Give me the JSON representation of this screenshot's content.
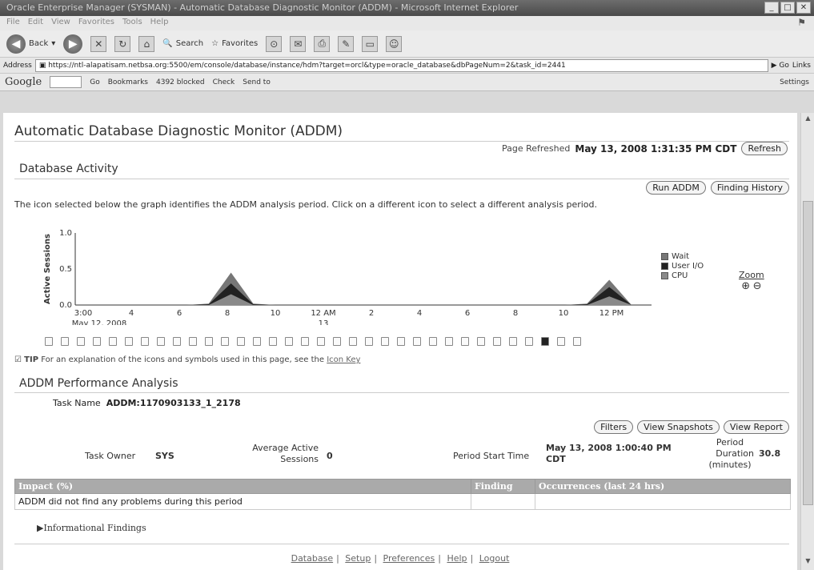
{
  "window": {
    "title": "Oracle Enterprise Manager (SYSMAN) - Automatic Database Diagnostic Monitor (ADDM) - Microsoft Internet Explorer"
  },
  "menu": [
    "File",
    "Edit",
    "View",
    "Favorites",
    "Tools",
    "Help"
  ],
  "toolbar": {
    "back": "Back",
    "search": "Search",
    "favorites": "Favorites"
  },
  "address": {
    "label": "Address",
    "url": "https://ntl-alapatisam.netbsa.org:5500/em/console/database/instance/hdm?target=orcl&type=oracle_database&dbPageNum=2&task_id=2441",
    "go": "Go",
    "links": "Links"
  },
  "googlebar": {
    "logo": "Google",
    "go": "Go",
    "bookmarks": "Bookmarks",
    "blocked": "4392 blocked",
    "check": "Check",
    "send_to": "Send to",
    "settings": "Settings"
  },
  "page": {
    "title": "Automatic Database Diagnostic Monitor (ADDM)",
    "refreshed_label": "Page Refreshed",
    "refreshed_value": "May 13, 2008 1:31:35 PM CDT",
    "refresh_button": "Refresh"
  },
  "activity": {
    "heading": "Database Activity",
    "run_addm": "Run ADDM",
    "finding_history": "Finding History",
    "description": "The icon selected below the graph identifies the ADDM analysis period. Click on a different icon to select a different analysis period.",
    "zoom_label": "Zoom",
    "tip_label": "TIP",
    "tip_text": "For an explanation of the icons and symbols used in this page, see the",
    "tip_link": "Icon Key"
  },
  "chart_data": {
    "type": "area",
    "ylabel": "Active Sessions",
    "ylim": [
      0,
      1.0
    ],
    "y_ticks": [
      "0.0",
      "0.5",
      "1.0"
    ],
    "x_ticks": [
      "3:00",
      "4",
      "6",
      "8",
      "10",
      "12 AM",
      "2",
      "4",
      "6",
      "8",
      "10",
      "12 PM"
    ],
    "x_subticks": [
      "May 12, 2008",
      "13"
    ],
    "series": [
      {
        "name": "Wait",
        "color": "#777777",
        "values": [
          0,
          0,
          0,
          0,
          0,
          0,
          0.02,
          0.45,
          0.02,
          0,
          0,
          0,
          0,
          0,
          0,
          0,
          0,
          0,
          0,
          0,
          0,
          0,
          0,
          0.02,
          0.35,
          0
        ]
      },
      {
        "name": "User I/O",
        "color": "#222222",
        "values": [
          0,
          0,
          0,
          0,
          0,
          0,
          0.01,
          0.3,
          0.01,
          0,
          0,
          0,
          0,
          0,
          0,
          0,
          0,
          0,
          0,
          0,
          0,
          0,
          0,
          0.01,
          0.25,
          0
        ]
      },
      {
        "name": "CPU",
        "color": "#8a8a8a",
        "values": [
          0,
          0,
          0,
          0,
          0,
          0,
          0,
          0.15,
          0,
          0,
          0,
          0,
          0,
          0,
          0,
          0,
          0,
          0,
          0,
          0,
          0,
          0,
          0,
          0,
          0.12,
          0
        ]
      }
    ],
    "legend": "right"
  },
  "analysis": {
    "heading": "ADDM Performance Analysis",
    "task_name_label": "Task Name",
    "task_name_value": "ADDM:1170903133_1_2178",
    "filters": "Filters",
    "view_snapshots": "View Snapshots",
    "view_report": "View Report",
    "task_owner_label": "Task Owner",
    "task_owner_value": "SYS",
    "avg_sessions_label_1": "Average Active",
    "avg_sessions_label_2": "Sessions",
    "avg_sessions_value": "0",
    "period_start_label": "Period Start Time",
    "period_start_value_1": "May 13, 2008 1:00:40 PM",
    "period_start_value_2": "CDT",
    "period_duration_label_1": "Period",
    "period_duration_label_2": "Duration",
    "period_duration_label_3": "(minutes)",
    "period_duration_value": "30.8"
  },
  "findings_table": {
    "headers": [
      "Impact (%)",
      "Finding",
      "Occurrences (last 24 hrs)"
    ],
    "rows": [
      [
        "ADDM did not find any problems during this period",
        "",
        ""
      ]
    ]
  },
  "informational": "Informational Findings",
  "footer": [
    "Database",
    "Setup",
    "Preferences",
    "Help",
    "Logout"
  ]
}
